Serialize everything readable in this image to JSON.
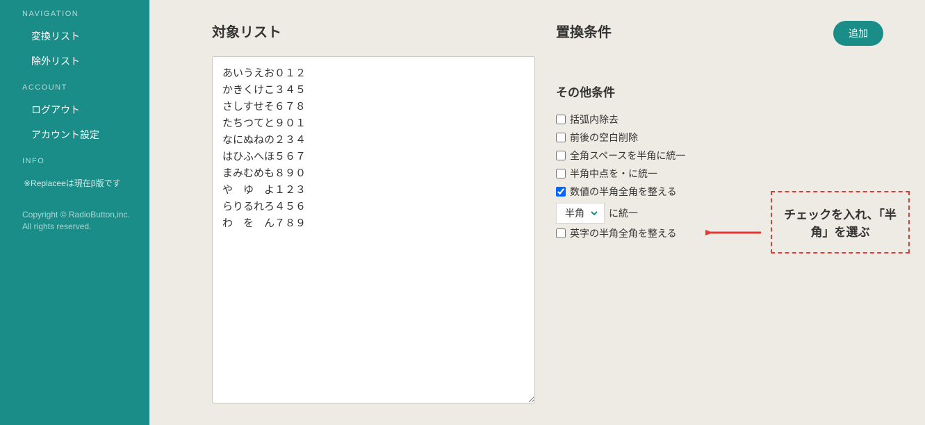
{
  "sidebar": {
    "sections": {
      "navigation": {
        "title": "NAVIGATION",
        "items": [
          "変換リスト",
          "除外リスト"
        ]
      },
      "account": {
        "title": "ACCOUNT",
        "items": [
          "ログアウト",
          "アカウント設定"
        ]
      },
      "info": {
        "title": "INFO",
        "text": "※Replaceeは現在β版です"
      }
    },
    "copyright": "Copyright © RadioButton,inc. All rights reserved."
  },
  "main": {
    "target_list": {
      "heading": "対象リスト",
      "value": "あいうえお０１２\nかきくけこ３４５\nさしすせそ６７８\nたちつてと９０１\nなにぬねの２３４\nはひふへほ５６７\nまみむめも８９０\nや　ゆ　よ１２３\nらりるれろ４５６\nわ　を　ん７８９"
    },
    "replace_conditions": {
      "heading": "置換条件",
      "add_button": "追加",
      "other_heading": "その他条件",
      "checkboxes": {
        "remove_brackets": {
          "label": "括弧内除去",
          "checked": false
        },
        "trim_whitespace": {
          "label": "前後の空白削除",
          "checked": false
        },
        "fullwidth_space": {
          "label": "全角スペースを半角に統一",
          "checked": false
        },
        "nakaguro": {
          "label": "半角中点を・に統一",
          "checked": false
        },
        "number_width": {
          "label": "数値の半角全角を整える",
          "checked": true
        },
        "alpha_width": {
          "label": "英字の半角全角を整える",
          "checked": false
        }
      },
      "number_select": {
        "selected": "半角",
        "suffix": "に統一"
      }
    },
    "annotation": "チェックを入れ、「半角」を選ぶ"
  }
}
